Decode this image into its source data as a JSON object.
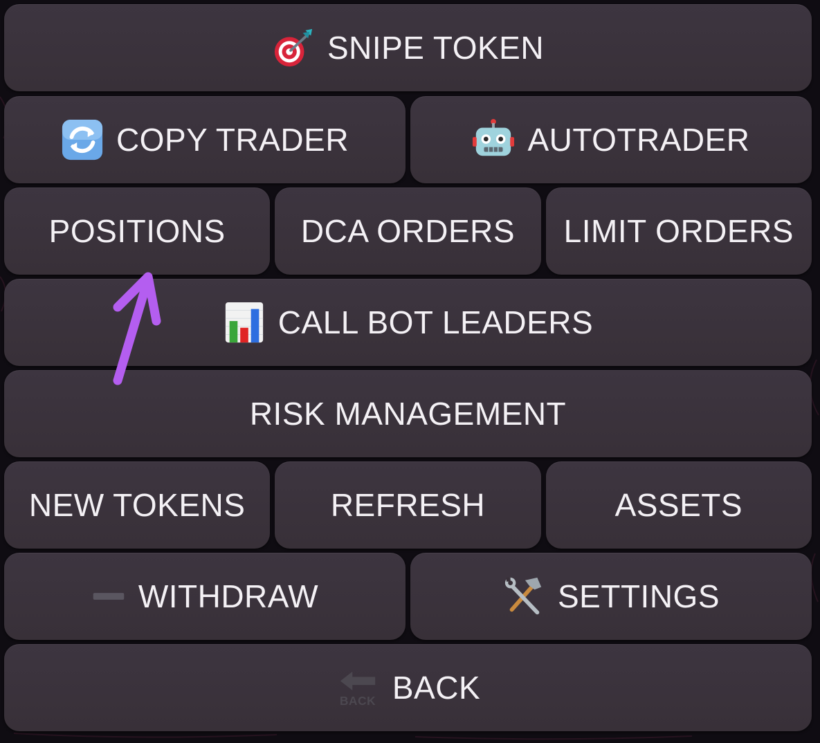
{
  "keyboard": {
    "snipe_token": {
      "label": "SNIPE TOKEN",
      "icon": "target-dart-icon"
    },
    "copy_trader": {
      "label": "COPY TRADER",
      "icon": "refresh-arrows-icon"
    },
    "autotrader": {
      "label": "AUTOTRADER",
      "icon": "robot-icon"
    },
    "positions": {
      "label": "POSITIONS"
    },
    "dca_orders": {
      "label": "DCA ORDERS"
    },
    "limit_orders": {
      "label": "LIMIT ORDERS"
    },
    "call_bot_leaders": {
      "label": "CALL BOT LEADERS",
      "icon": "bar-chart-icon"
    },
    "risk_management": {
      "label": "RISK MANAGEMENT"
    },
    "new_tokens": {
      "label": "NEW TOKENS"
    },
    "refresh": {
      "label": "REFRESH"
    },
    "assets": {
      "label": "ASSETS"
    },
    "withdraw": {
      "label": "WITHDRAW",
      "icon": "minus-icon"
    },
    "settings": {
      "label": "SETTINGS",
      "icon": "hammer-wrench-icon"
    },
    "back": {
      "label": "BACK",
      "icon": "back-arrow-icon",
      "icon_text": "BACK"
    }
  },
  "colors": {
    "key_bg": "#3a3239",
    "text": "#f4f1f5",
    "annotation_arrow": "#b45ef0"
  }
}
